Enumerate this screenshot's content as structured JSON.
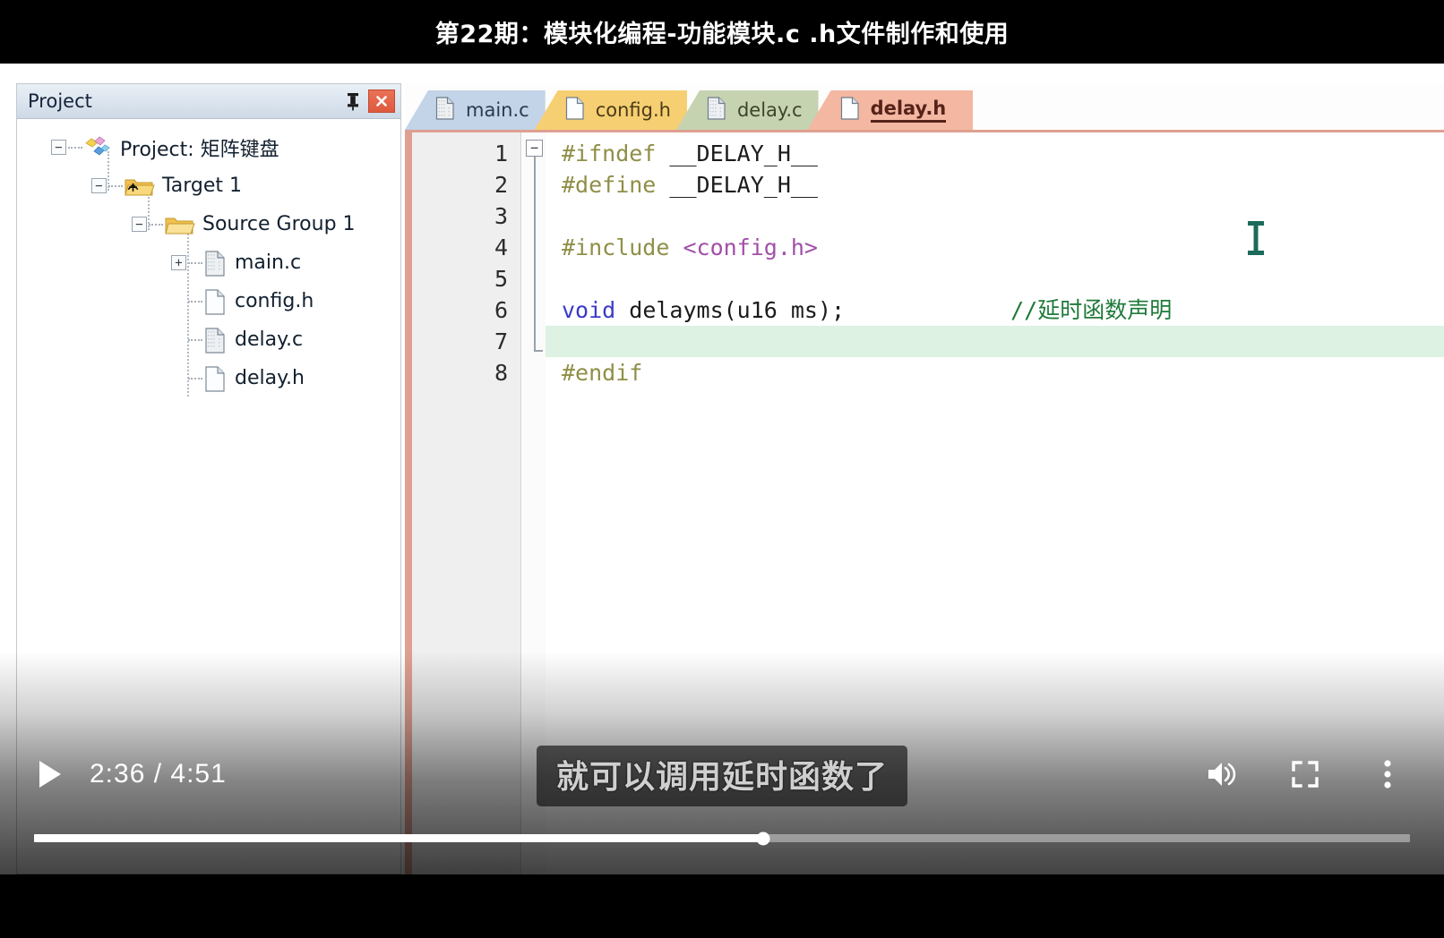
{
  "video": {
    "title": "第22期：模块化编程-功能模块.c .h文件制作和使用",
    "subtitle": "就可以调用延时函数了",
    "current_time": "2:36",
    "duration": "4:51",
    "time_display": "2:36 / 4:51",
    "progress_percent": 53,
    "play_icon": "play-icon",
    "volume_icon": "volume-on-icon",
    "fullscreen_icon": "fullscreen-icon",
    "more_icon": "more-options-icon"
  },
  "project_panel": {
    "title": "Project",
    "pin_icon": "pin-icon",
    "close_icon": "close-icon",
    "tree": [
      {
        "label": "Project: 矩阵键盘",
        "icon": "project-diamond-icon",
        "expander": "−",
        "depth": 0
      },
      {
        "label": "Target 1",
        "icon": "target-folder-icon",
        "expander": "−",
        "depth": 1
      },
      {
        "label": "Source Group 1",
        "icon": "folder-icon",
        "expander": "−",
        "depth": 2
      },
      {
        "label": "main.c",
        "icon": "c-file-icon",
        "expander": "+",
        "depth": 3
      },
      {
        "label": "config.h",
        "icon": "h-file-icon",
        "expander": "",
        "depth": 3
      },
      {
        "label": "delay.c",
        "icon": "c-file-icon",
        "expander": "",
        "depth": 3
      },
      {
        "label": "delay.h",
        "icon": "h-file-icon",
        "expander": "",
        "depth": 3
      }
    ]
  },
  "editor": {
    "tabs": [
      {
        "label": "main.c",
        "color": "#c3d3e8",
        "active": false
      },
      {
        "label": "config.h",
        "color": "#f6cf72",
        "active": false
      },
      {
        "label": "delay.c",
        "color": "#c6d3b1",
        "active": false
      },
      {
        "label": "delay.h",
        "color": "#f4b7a1",
        "active": true
      }
    ],
    "active_file": "delay.h",
    "line_numbers": [
      "1",
      "2",
      "3",
      "4",
      "5",
      "6",
      "7",
      "8"
    ],
    "highlighted_line": 7,
    "fold_marker": "−",
    "code": {
      "l1_pp": "#ifndef",
      "l1_id": " __DELAY_H__",
      "l2_pp": "#define",
      "l2_id": " __DELAY_H__",
      "l3": "",
      "l4_pp": "#include",
      "l4_inc": " <config.h>",
      "l5": "",
      "l6_kw": "void",
      "l6_rest": " delayms(u16 ms);",
      "l6_comment": "//延时函数声明",
      "l7": "",
      "l8_pp": "#endif"
    },
    "colors": {
      "preprocessor": "#8f8f48",
      "include_path": "#a24fa8",
      "keyword": "#3a3acb",
      "comment": "#1f7a3a",
      "highlight_bg": "#ddf2e2",
      "border_accent": "#dfa091"
    }
  }
}
